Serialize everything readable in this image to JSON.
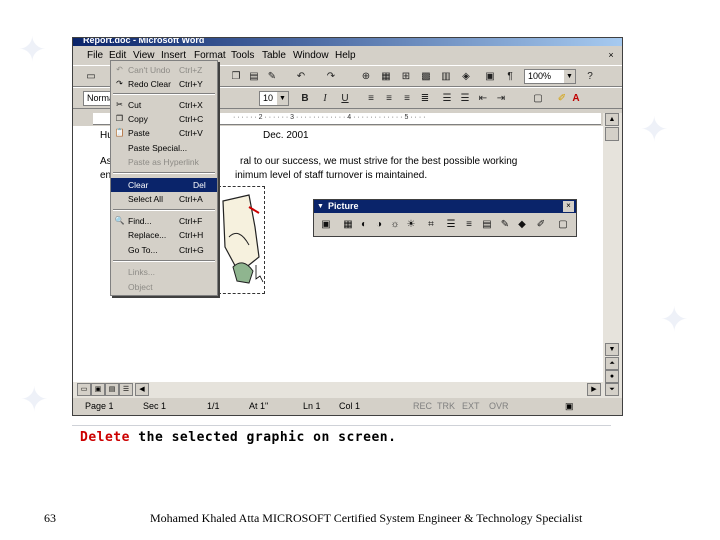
{
  "window": {
    "title": "Report.doc - Microsoft Word",
    "controls": [
      "_",
      "□",
      "×"
    ],
    "doc_controls": [
      "×"
    ]
  },
  "menubar": [
    "File",
    "Edit",
    "View",
    "Insert",
    "Format",
    "Tools",
    "Table",
    "Window",
    "Help"
  ],
  "standard_toolbar": {
    "zoom": "100%"
  },
  "formatting_toolbar": {
    "style": "Normal",
    "font_size": "10",
    "bold": "B",
    "italic": "I",
    "underline": "U"
  },
  "document": {
    "line1_start": "Hu",
    "line1_end": "Dec. 2001",
    "line2_start": "As",
    "line2_end": "ral to our success, we must strive for the best possible working",
    "line3_start": "en",
    "line3_end": "inimum level of staff turnover is maintained."
  },
  "edit_menu": {
    "items": [
      {
        "label": "Can't Undo",
        "shortcut": "Ctrl+Z",
        "disabled": true,
        "icon": "↶"
      },
      {
        "label": "Redo Clear",
        "shortcut": "Ctrl+Y",
        "disabled": false,
        "icon": "↷"
      },
      {
        "label": "Cut",
        "shortcut": "Ctrl+X",
        "disabled": false,
        "icon": "✂"
      },
      {
        "label": "Copy",
        "shortcut": "Ctrl+C",
        "disabled": false,
        "icon": "❐"
      },
      {
        "label": "Paste",
        "shortcut": "Ctrl+V",
        "disabled": false,
        "icon": "📋"
      },
      {
        "label": "Paste Special...",
        "shortcut": "",
        "disabled": false,
        "icon": ""
      },
      {
        "label": "Paste as Hyperlink",
        "shortcut": "",
        "disabled": true,
        "icon": ""
      },
      {
        "label": "Clear",
        "shortcut": "Del",
        "disabled": false,
        "selected": true,
        "icon": ""
      },
      {
        "label": "Select All",
        "shortcut": "Ctrl+A",
        "disabled": false,
        "icon": ""
      },
      {
        "label": "Find...",
        "shortcut": "Ctrl+F",
        "disabled": false,
        "icon": "🔍"
      },
      {
        "label": "Replace...",
        "shortcut": "Ctrl+H",
        "disabled": false,
        "icon": ""
      },
      {
        "label": "Go To...",
        "shortcut": "Ctrl+G",
        "disabled": false,
        "icon": ""
      },
      {
        "label": "Links...",
        "shortcut": "",
        "disabled": true,
        "icon": ""
      },
      {
        "label": "Object",
        "shortcut": "",
        "disabled": true,
        "icon": ""
      }
    ]
  },
  "picture_toolbar": {
    "title": "Picture",
    "close": "×"
  },
  "statusbar": {
    "page": "Page 1",
    "sec": "Sec 1",
    "pages": "1/1",
    "at": "At 1\"",
    "ln": "Ln 1",
    "col": "Col 1",
    "rec": "REC",
    "trk": "TRK",
    "ext": "EXT",
    "ovr": "OVR"
  },
  "caption": {
    "word1": "Delete",
    "rest": "the selected graphic on screen."
  },
  "footer": {
    "slide_number": "63",
    "author": "Mohamed Khaled Atta MICROSOFT Certified System Engineer & Technology Specialist"
  },
  "colors": {
    "titlebar": "#0a246a",
    "menu_selected": "#0a246a",
    "caption_red": "#cc0000",
    "face": "#d4d0c8"
  }
}
